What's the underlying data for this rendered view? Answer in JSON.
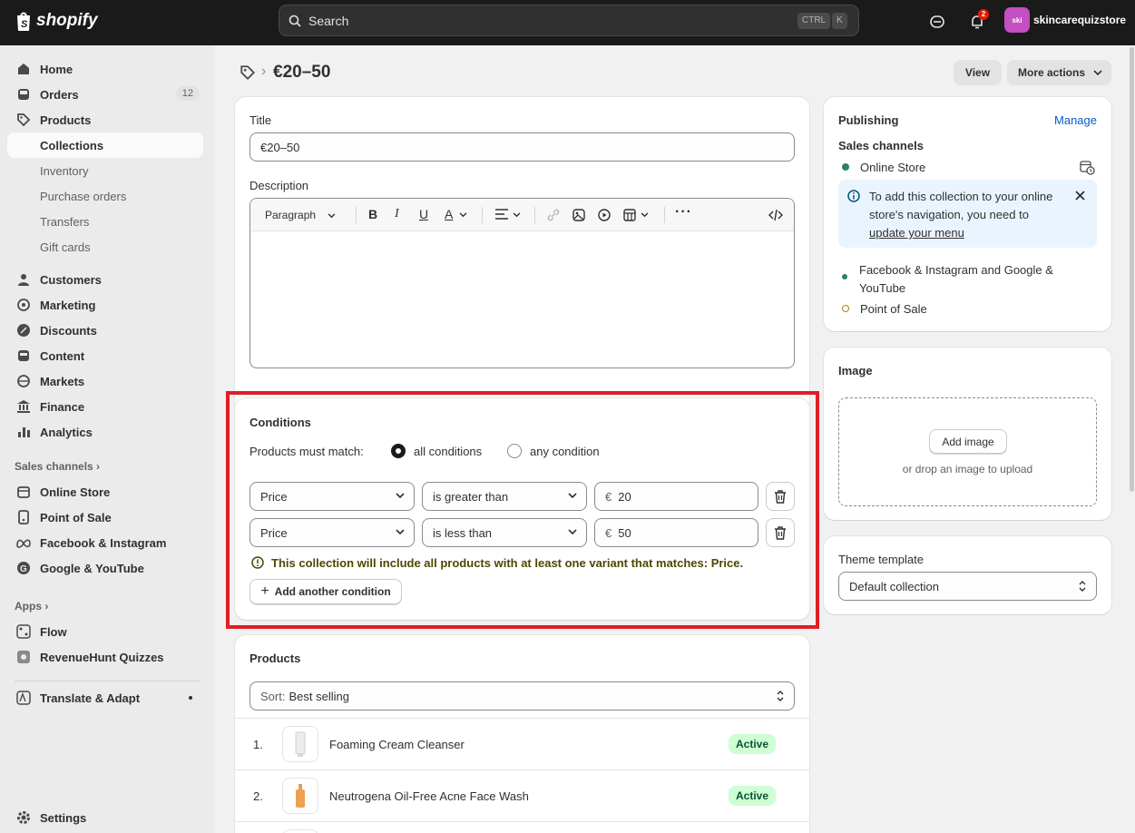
{
  "topbar": {
    "logo_text": "shopify",
    "search_placeholder": "Search",
    "shortcut_ctrl": "CTRL",
    "shortcut_k": "K",
    "notifications_count": "2",
    "avatar_initials": "ski",
    "store_name": "skincarequizstore"
  },
  "sidebar": {
    "items": [
      {
        "label": "Home"
      },
      {
        "label": "Orders",
        "badge": "12"
      },
      {
        "label": "Products"
      },
      {
        "label": "Collections"
      },
      {
        "label": "Inventory"
      },
      {
        "label": "Purchase orders"
      },
      {
        "label": "Transfers"
      },
      {
        "label": "Gift cards"
      },
      {
        "label": "Customers"
      },
      {
        "label": "Marketing"
      },
      {
        "label": "Discounts"
      },
      {
        "label": "Content"
      },
      {
        "label": "Markets"
      },
      {
        "label": "Finance"
      },
      {
        "label": "Analytics"
      }
    ],
    "sales_channels_label": "Sales channels",
    "channels": [
      {
        "label": "Online Store"
      },
      {
        "label": "Point of Sale"
      },
      {
        "label": "Facebook & Instagram"
      },
      {
        "label": "Google & YouTube"
      }
    ],
    "apps_label": "Apps",
    "apps": [
      {
        "label": "Flow"
      },
      {
        "label": "RevenueHunt Quizzes"
      },
      {
        "label": "Translate & Adapt"
      }
    ],
    "settings_label": "Settings"
  },
  "header": {
    "title": "€20–50",
    "view_label": "View",
    "more_actions_label": "More actions"
  },
  "details": {
    "title_label": "Title",
    "title_value": "€20–50",
    "description_label": "Description",
    "paragraph_label": "Paragraph"
  },
  "conditions": {
    "heading": "Conditions",
    "match_label": "Products must match:",
    "all_label": "all conditions",
    "any_label": "any condition",
    "rules": [
      {
        "field": "Price",
        "operator": "is greater than",
        "currency": "€",
        "value": "20"
      },
      {
        "field": "Price",
        "operator": "is less than",
        "currency": "€",
        "value": "50"
      }
    ],
    "warning": "This collection will include all products with at least one variant that matches: Price.",
    "add_label": "Add another condition"
  },
  "products": {
    "heading": "Products",
    "sort_prefix": "Sort:",
    "sort_value": "Best selling",
    "items": [
      {
        "index": "1.",
        "name": "Foaming Cream Cleanser",
        "status": "Active"
      },
      {
        "index": "2.",
        "name": "Neutrogena Oil-Free Acne Face Wash",
        "status": "Active"
      }
    ]
  },
  "publishing": {
    "heading": "Publishing",
    "manage_label": "Manage",
    "sales_channels_label": "Sales channels",
    "online_store": "Online Store",
    "banner_text": "To add this collection to your online store's navigation, you need to",
    "banner_link": "update your menu",
    "fb_google": "Facebook & Instagram and Google & YouTube",
    "pos": "Point of Sale"
  },
  "image": {
    "heading": "Image",
    "add_label": "Add image",
    "hint": "or drop an image to upload"
  },
  "theme": {
    "heading": "Theme template",
    "value": "Default collection"
  },
  "colors": {
    "topbar": "#1a1a1a",
    "accent_link": "#005bd3",
    "highlight_box": "#e01e25",
    "active_badge_bg": "#cdfed4",
    "channel_green": "#29845a"
  }
}
